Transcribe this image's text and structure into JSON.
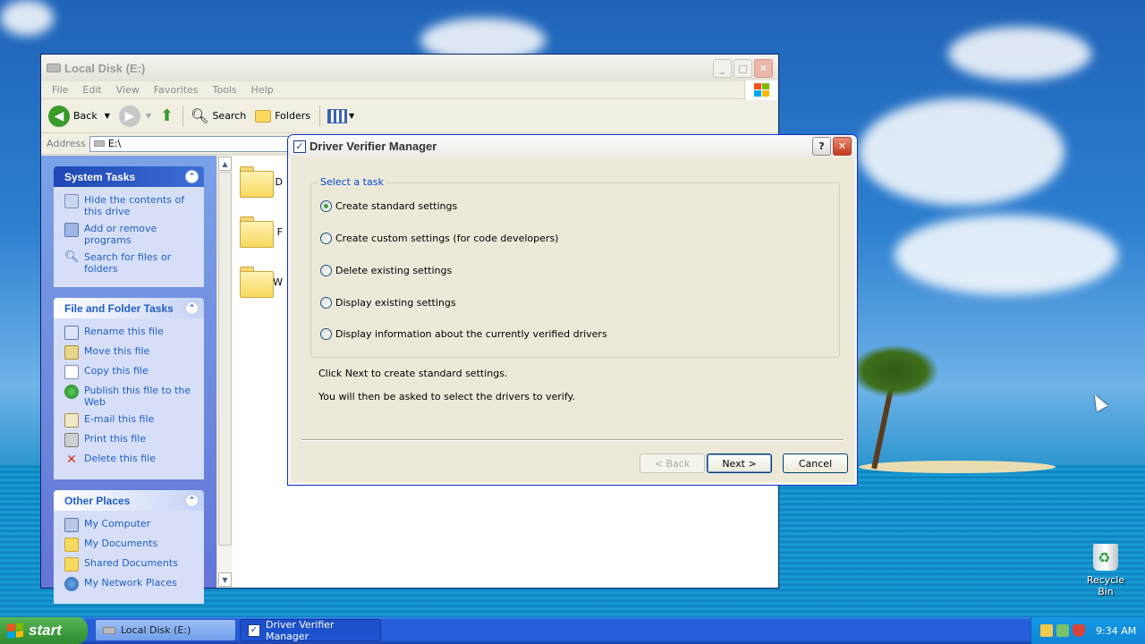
{
  "explorer": {
    "title": "Local Disk (E:)",
    "menu": [
      "File",
      "Edit",
      "View",
      "Favorites",
      "Tools",
      "Help"
    ],
    "toolbar": {
      "back": "Back",
      "search": "Search",
      "folders": "Folders"
    },
    "address_label": "Address",
    "address_value": "E:\\",
    "panels": {
      "system_tasks": {
        "title": "System Tasks",
        "items": [
          "Hide the contents of this drive",
          "Add or remove programs",
          "Search for files or folders"
        ]
      },
      "file_folder_tasks": {
        "title": "File and Folder Tasks",
        "items": [
          "Rename this file",
          "Move this file",
          "Copy this file",
          "Publish this file to the Web",
          "E-mail this file",
          "Print this file",
          "Delete this file"
        ]
      },
      "other_places": {
        "title": "Other Places",
        "items": [
          "My Computer",
          "My Documents",
          "Shared Documents",
          "My Network Places"
        ]
      }
    },
    "folders": [
      "D",
      "F",
      "W"
    ]
  },
  "dialog": {
    "title": "Driver Verifier Manager",
    "group_label": "Select a task",
    "options": [
      "Create standard settings",
      "Create custom settings (for code developers)",
      "Delete existing settings",
      "Display existing settings",
      "Display information about the currently verified drivers"
    ],
    "selected_option": 0,
    "info_line1": "Click Next to create standard settings.",
    "info_line2": "You will then be asked to select the drivers to verify.",
    "buttons": {
      "back": "< Back",
      "next": "Next >",
      "cancel": "Cancel"
    }
  },
  "taskbar": {
    "start": "start",
    "tasks": [
      "Local Disk (E:)",
      "Driver Verifier Manager"
    ],
    "clock": "9:34 AM"
  },
  "desktop": {
    "recycle_bin": "Recycle Bin"
  },
  "colors": {
    "xp_blue": "#0046d5",
    "link_blue": "#215dc6",
    "taskbar": "#245edb",
    "start_green": "#3c9b3c"
  }
}
